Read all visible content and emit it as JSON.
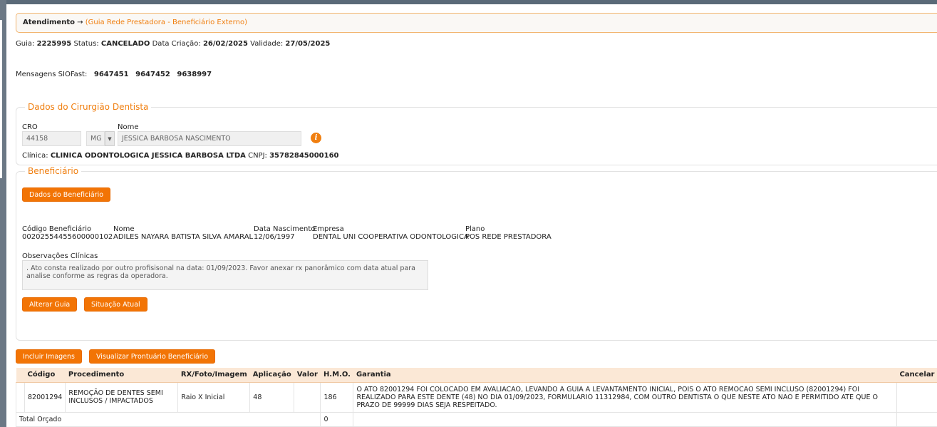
{
  "breadcrumb": {
    "title": "Atendimento",
    "arrow": "→",
    "sub": "(Guia Rede Prestadora - Beneficiário Externo)"
  },
  "guia": {
    "guia_label": "Guia:",
    "guia_value": "2225995",
    "status_label": "Status:",
    "status_value": "CANCELADO",
    "criacao_label": "Data Criação:",
    "criacao_value": "26/02/2025",
    "validade_label": "Validade:",
    "validade_value": "27/05/2025"
  },
  "mensagens": {
    "label": "Mensagens SIOFast:",
    "values": [
      "9647451",
      "9647452",
      "9638997"
    ]
  },
  "dentista": {
    "legend": "Dados do Cirurgião Dentista",
    "cro_label": "CRO",
    "cro_value": "44158",
    "uf_value": "MG",
    "nome_label": "Nome",
    "nome_value": "JESSICA BARBOSA NASCIMENTO",
    "info_icon": "i",
    "clinica_label": "Clínica:",
    "clinica_value": "CLINICA ODONTOLOGICA JESSICA BARBOSA LTDA",
    "cnpj_label": "CNPJ:",
    "cnpj_value": "35782845000160"
  },
  "beneficiario": {
    "legend": "Beneficiário",
    "dados_button": "Dados do Beneficiário",
    "codigo_label": "Código Beneficiário",
    "codigo_value": "00202554455600000102",
    "nome_label": "Nome",
    "nome_value": "ADILES NAYARA BATISTA SILVA AMARAL",
    "nasc_label": "Data Nascimento",
    "nasc_value": "12/06/1997",
    "empresa_label": "Empresa",
    "empresa_value": "DENTAL UNI COOPERATIVA ODONTOLOGICA",
    "plano_label": "Plano",
    "plano_value": "POS REDE PRESTADORA",
    "obs_label": "Observações Clínicas",
    "obs_value": ". Ato consta realizado por outro profisisonal na data: 01/09/2023. Favor anexar rx panorâmico com data atual para analise conforme as regras da operadora.",
    "alterar_button": "Alterar Guia",
    "situacao_button": "Situação Atual"
  },
  "actions": {
    "incluir_button": "Incluir Imagens",
    "prontuario_button": "Visualizar Prontuário Beneficiário"
  },
  "table": {
    "headers": [
      "",
      "Código",
      "Procedimento",
      "RX/Foto/Imagem",
      "Aplicação",
      "Valor",
      "H.M.O.",
      "Garantia",
      "Cancelar"
    ],
    "rows": [
      {
        "codigo": "82001294",
        "procedimento": "REMOÇÃO DE DENTES SEMI INCLUSOS / IMPACTADOS",
        "rx": "Raio X Inicial",
        "aplicacao": "48",
        "valor": "",
        "hmo": "186",
        "garantia": "O ATO 82001294 FOI COLOCADO EM AVALIACAO, LEVANDO A GUIA A LEVANTAMENTO INICIAL, POIS O ATO REMOCAO SEMI INCLUSO (82001294) FOI REALIZADO PARA ESTE DENTE (48) NO DIA 01/09/2023, FORMULARIO 11312984, COM OUTRO DENTISTA O QUE NESTE ATO NAO E PERMITIDO ATE QUE O PRAZO DE 99999 DIAS SEJA RESPEITADO.",
        "cancelar": ""
      }
    ],
    "total_label": "Total Orçado",
    "total_value": "0"
  },
  "colors": {
    "accent": "#f27405",
    "legend": "#f07f10",
    "header_bg": "#fbe8d6"
  }
}
